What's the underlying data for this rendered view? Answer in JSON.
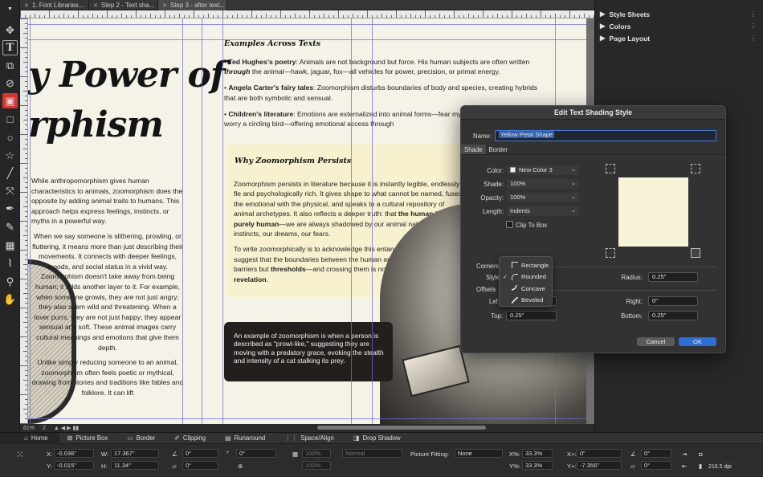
{
  "tabs": [
    {
      "label": "1. Font Libraries..."
    },
    {
      "label": "Step 2 - Text sha..."
    },
    {
      "label": "Step 3 - after text..."
    }
  ],
  "tools": [
    "move-icon",
    "text-icon",
    "linked-text-icon",
    "unlink-icon",
    "picture-tool-icon",
    "rectangle-icon",
    "ellipse-icon",
    "star-icon",
    "line-icon",
    "bezier-icon",
    "pen-icon",
    "content-icon",
    "table-icon",
    "eyedropper-icon",
    "zoom-icon",
    "hand-icon"
  ],
  "document": {
    "big_title_line1": "y Power of",
    "big_title_line2": "rphism",
    "left_col": [
      "While anthropomorphism gives human characteristics to animals, zoomorphism does the opposite by adding animal traits to humans. This approach helps express feelings, instincts, or myths in a powerful way.",
      "When we say someone is slithering, prowling, or fluttering, it means more than just describing their movements. It connects with deeper feelings, moods, and social status in a vivid way. Zoomorphism doesn't take away from being human; it adds another layer to it. For example, when someone growls, they are not just angry; they also seem wild and threatening. When a lover purrs, they are not just happy; they appear sensual and soft. These animal images carry cultural meanings and emotions that give them depth.",
      "Unlike simply reducing someone to an animal, zoomorphism often feels poetic or mythical, drawing from stories and traditions like fables and folklore. It can lift"
    ],
    "examples_heading": "Examples Across Texts",
    "examples": [
      {
        "bold": "Ted Hughes's poetry",
        "text": ": Animals are not background but force. His human subjects are often written ",
        "em": "through",
        "tail": " the animal—hawk, jaguar, fox—all vehicles for power, precision, or primal energy."
      },
      {
        "bold": "Angela Carter's fairy tales",
        "text": ": Zoomorphism disturbs boundaries of body and species, creating hybrids that are both symbolic and sensual.",
        "em": "",
        "tail": ""
      },
      {
        "bold": "Children's literature",
        "text": ": Emotions are externalized into animal forms—fear my",
        "em": "",
        "tail": " joy a bounding rabbit, worry a circling bird—offering emotional access through"
      }
    ],
    "why_heading": "Why Zoomorphism Persists",
    "why_p1": "Zoomorphism persists in literature because it is instantly legible, endlessly fle and psychologically rich. It gives shape to what cannot be named, fuses the emotional with the physical, and speaks to a cultural repository of animal archetypes. It also reflects a deeper truth: that",
    "why_p1_bold": " the human is never purely human",
    "why_p1_tail": "—we are always shadowed by our animal nature, our instincts, our dreams, our fears.",
    "why_p2": "To write zoomorphically is to acknowledge this entanglement. It is to suggest that the boundaries between the human and the animal are not barriers but",
    "why_p2_bold1": " thresholds",
    "why_p2_mid": "—and crossing them is not a fall, but a form of",
    "why_p2_bold2": " revelation",
    "why_p2_end": ".",
    "dark_text": "An example of zoomorphism is when a person is described as \"prowl-like,\" suggesting they are moving with a predatory grace, evoking the stealth and intensity of a cat stalking its prey."
  },
  "statusbar": {
    "zoom": "61%",
    "page": "2"
  },
  "right_panel": [
    {
      "label": "Style Sheets"
    },
    {
      "label": "Colors"
    },
    {
      "label": "Page Layout"
    }
  ],
  "dialog": {
    "title": "Edit Text Shading Style",
    "name_label": "Name:",
    "name_value": "Yellow Petal Shape",
    "tab_shade": "Shade",
    "tab_border": "Border",
    "color_label": "Color:",
    "color_value": "New Color 3",
    "shade_label": "Shade:",
    "shade_value": "100%",
    "opacity_label": "Opacity:",
    "opacity_value": "100%",
    "length_label": "Length:",
    "length_value": "Indents",
    "clip_label": "Clip To Box",
    "corners_label": "Corners",
    "style_label": "Style",
    "radius_label": "Radius:",
    "radius_value": "0.25\"",
    "offsets_label": "Offsets",
    "left_label": "Lef",
    "right_label": "Right:",
    "right_value": "0\"",
    "top_label": "Top:",
    "top_value": "0.25\"",
    "bottom_label": "Bottom:",
    "bottom_value": "0.25\"",
    "cancel": "Cancel",
    "ok": "OK",
    "corner_menu": [
      {
        "label": "Rectangle",
        "checked": false
      },
      {
        "label": "Rounded",
        "checked": true
      },
      {
        "label": "Concave",
        "checked": false
      },
      {
        "label": "Beveled",
        "checked": false
      }
    ]
  },
  "measurements": {
    "tabs": [
      "Home",
      "Picture Box",
      "Border",
      "Clipping",
      "Runaround",
      "Space/Align",
      "Drop Shadow"
    ],
    "x_label": "X:",
    "x_value": "-0.036\"",
    "y_label": "Y:",
    "y_value": "-0.015\"",
    "w_label": "W:",
    "w_value": "17.367\"",
    "h_label": "H:",
    "h_value": "11.34\"",
    "angle1": "0°",
    "angle2": "0°",
    "angle3": "0°",
    "opacity1": "100%",
    "opacity2": "100%",
    "blend": "Normal",
    "picture_fitting_label": "Picture Fitting:",
    "picture_fitting_value": "None",
    "xpct_label": "X%:",
    "xpct_value": "33.3%",
    "ypct_label": "Y%:",
    "ypct_value": "33.3%",
    "xplus_label": "X+:",
    "xplus_value": "0\"",
    "yplus_label": "Y+:",
    "yplus_value": "-7.356\"",
    "rot1": "0°",
    "rot2": "0°",
    "dpi": "216.5 dpi"
  }
}
